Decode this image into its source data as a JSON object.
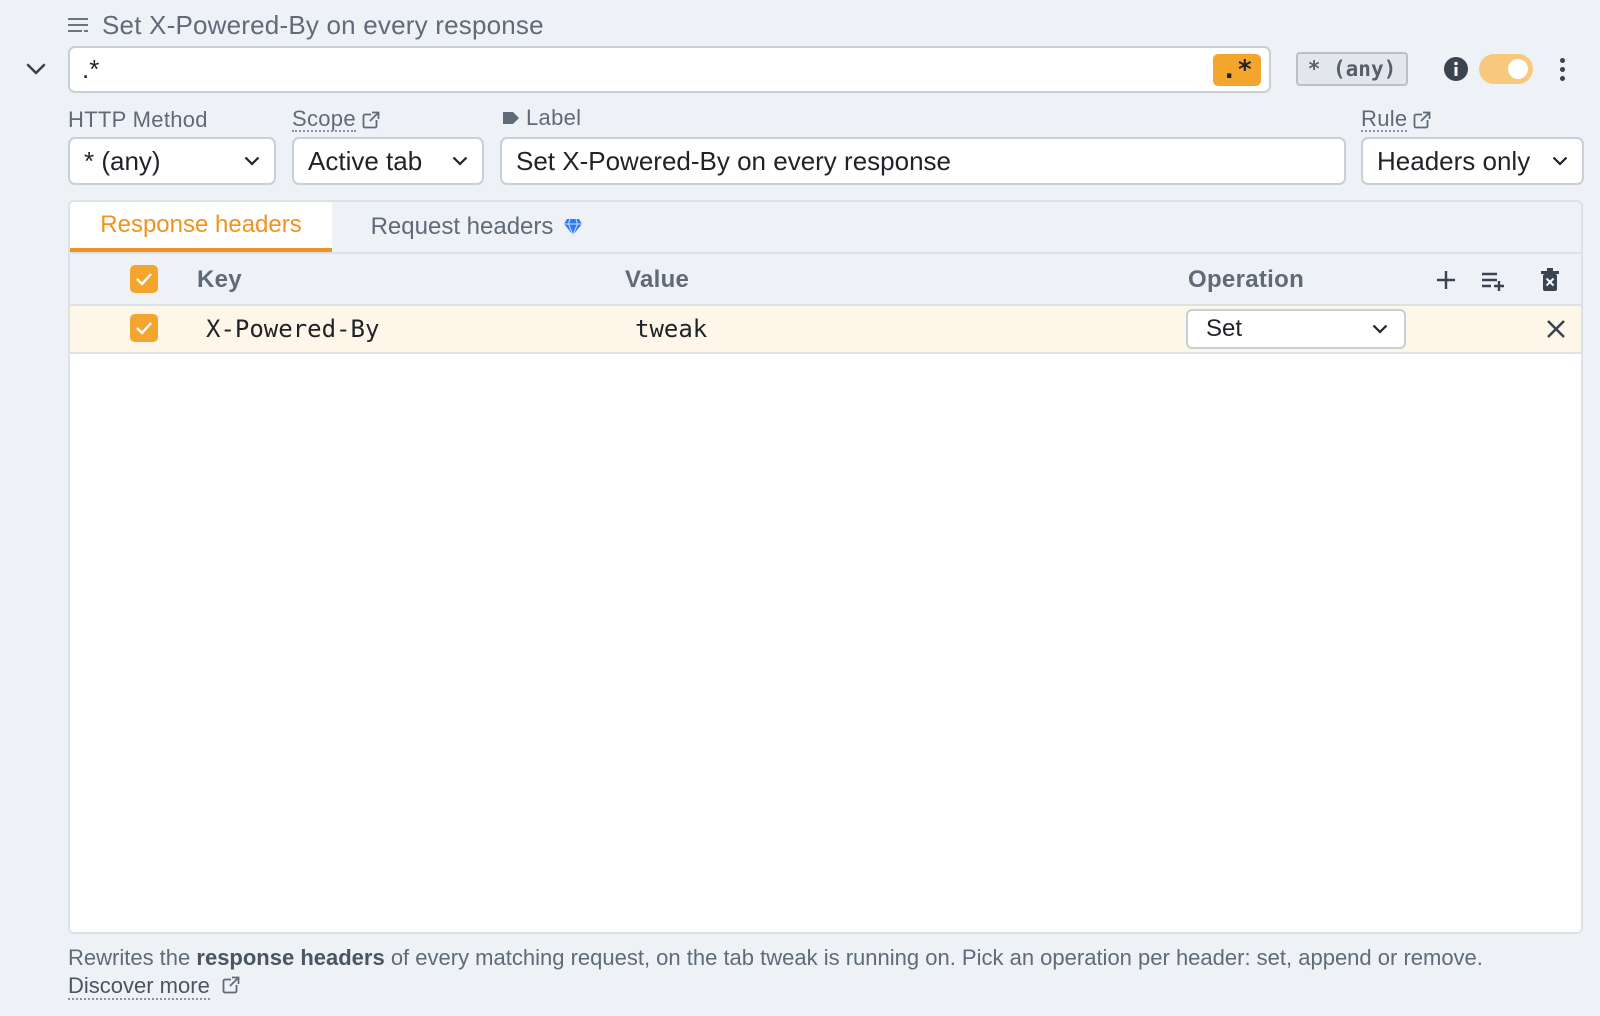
{
  "rule": {
    "title": "Set X-Powered-By on every response",
    "url_pattern": ".*",
    "regex_badge": ".*",
    "method_badge": "* (any)",
    "enabled": true
  },
  "fields": {
    "http_method_label": "HTTP Method",
    "http_method_value": "* (any)",
    "scope_label": "Scope",
    "scope_value": "Active tab",
    "label_label": "Label",
    "label_value": "Set X-Powered-By on every response",
    "rule_label": "Rule",
    "rule_value": "Headers only"
  },
  "tabs": {
    "active": "Response headers",
    "other": "Request headers"
  },
  "table": {
    "headers": {
      "key": "Key",
      "value": "Value",
      "operation": "Operation"
    },
    "rows": [
      {
        "key": "X-Powered-By",
        "value": "tweak",
        "operation": "Set",
        "checked": true
      }
    ]
  },
  "footer": {
    "text_before": "Rewrites the ",
    "bold": "response headers",
    "text_after": " of every matching request, on the tab tweak is running on. Pick an operation per header: set, append or remove. ",
    "link": "Discover more"
  },
  "colors": {
    "accent": "#f4a52d",
    "tab_active": "#f0921f",
    "row_highlight": "#fff6ea"
  },
  "icons": {
    "title": "list-icon",
    "collapse": "chevron-down-icon",
    "info": "info-icon",
    "external": "external-link-icon",
    "label": "tag-icon",
    "premium": "diamond-icon",
    "add": "plus-icon",
    "add_row": "playlist-add-icon",
    "delete_all": "trash-icon",
    "remove_row": "close-icon"
  }
}
